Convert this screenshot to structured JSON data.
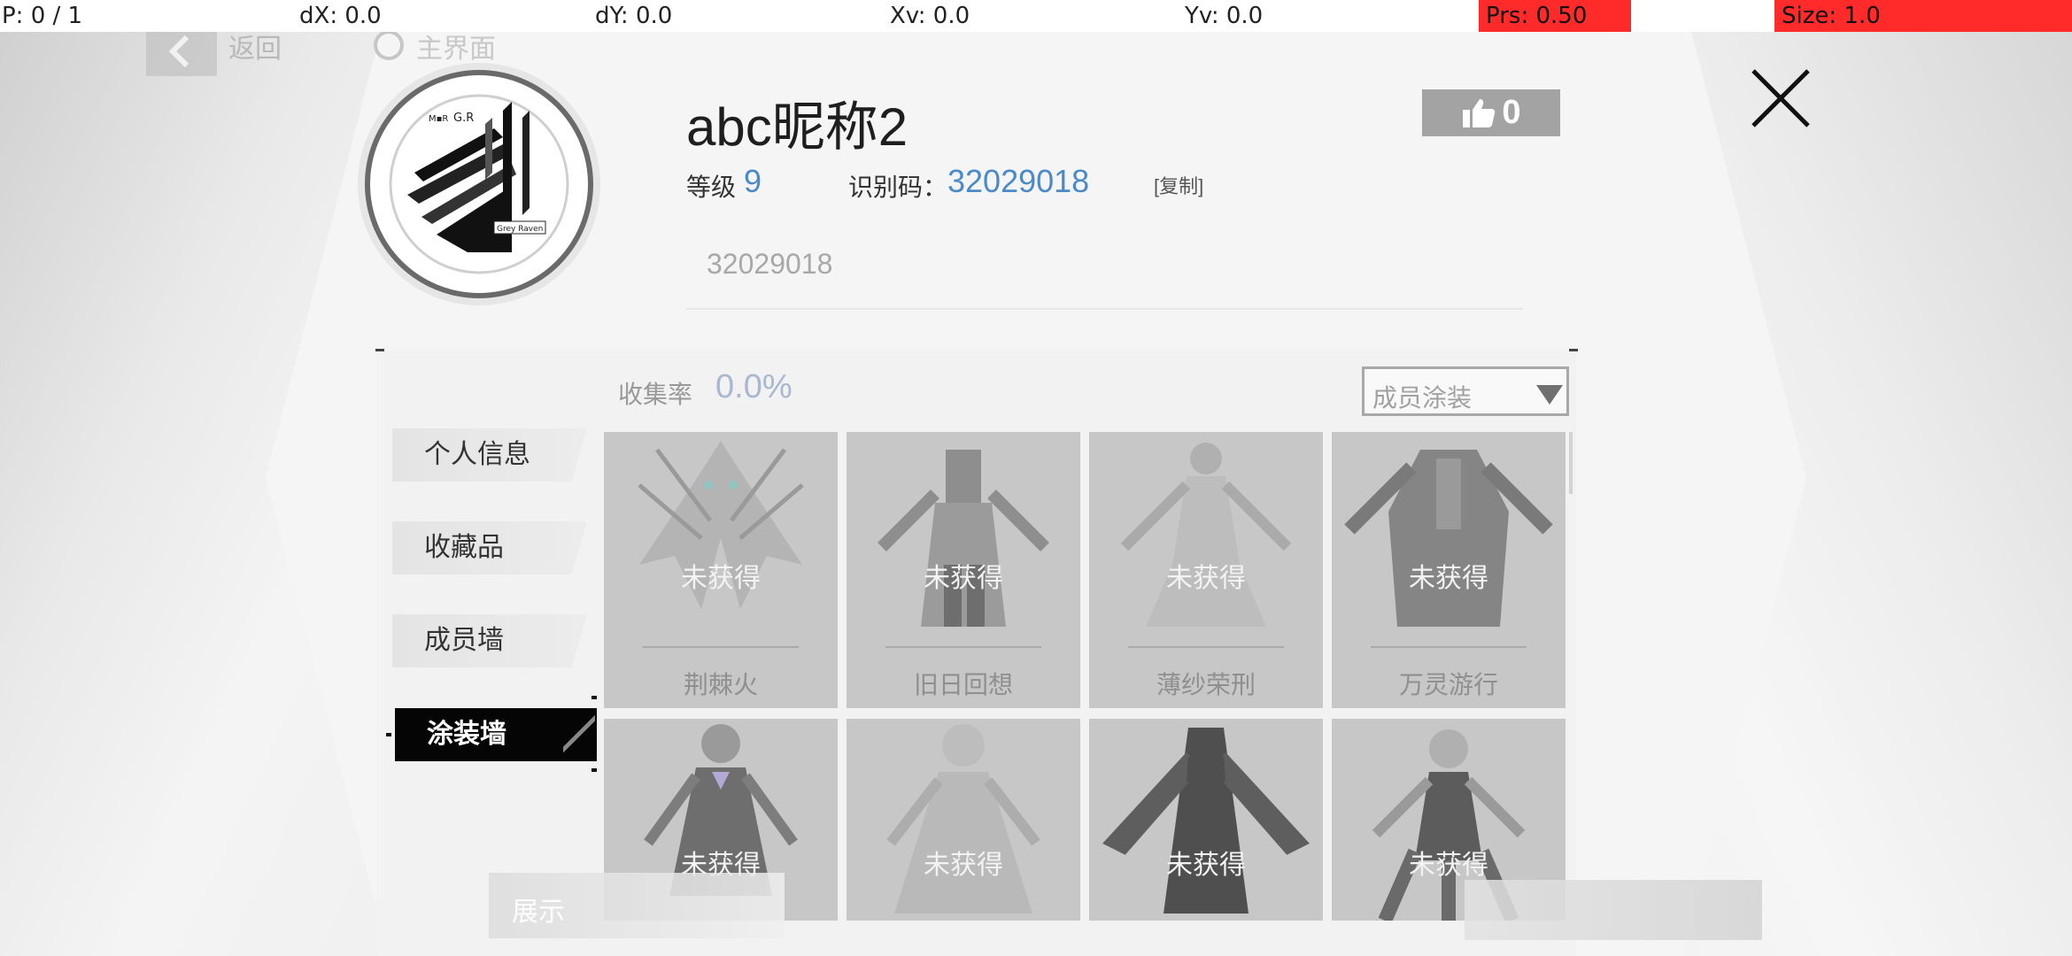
{
  "debug": {
    "p": "P: 0 / 1",
    "dx": "dX: 0.0",
    "dy": "dY: 0.0",
    "xv": "Xv: 0.0",
    "yv": "Yv: 0.0",
    "prs": "Prs: 0.50",
    "size": "Size: 1.0"
  },
  "nav": {
    "back_label": "返回",
    "home_label": "主界面"
  },
  "profile": {
    "nickname": "abc昵称2",
    "level_label": "等级",
    "level_value": "9",
    "id_label": "识别码：",
    "id_value": "32029018",
    "copy_label": "[复制]",
    "sub_id": "32029018",
    "likes": "0"
  },
  "sidebar": {
    "items": [
      {
        "label": "个人信息"
      },
      {
        "label": "收藏品"
      },
      {
        "label": "成员墙"
      },
      {
        "label": "涂装墙"
      }
    ],
    "active_index": 3
  },
  "collection": {
    "rate_label": "收集率",
    "rate_value": "0.0%",
    "filter_selected": "成员涂装"
  },
  "cards": [
    {
      "status": "未获得",
      "name": "荆棘火"
    },
    {
      "status": "未获得",
      "name": "旧日回想"
    },
    {
      "status": "未获得",
      "name": "薄纱荣刑"
    },
    {
      "status": "未获得",
      "name": "万灵游行"
    },
    {
      "status": "未获得",
      "name": ""
    },
    {
      "status": "未获得",
      "name": ""
    },
    {
      "status": "未获得",
      "name": ""
    },
    {
      "status": "未获得",
      "name": ""
    }
  ],
  "bottom": {
    "left_label": "展示"
  },
  "colors": {
    "accent_blue": "#4a8ac9",
    "debug_red": "#ff2b2b",
    "active_tab": "#050505"
  },
  "icons": {
    "back": "chevron-left-icon",
    "home": "circle-icon",
    "like": "thumbs-up-icon",
    "close": "close-icon",
    "dropdown": "triangle-down-icon"
  }
}
